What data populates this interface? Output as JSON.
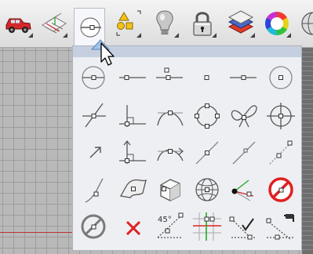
{
  "toolbar": {
    "buttons": [
      {
        "name": "car-icon"
      },
      {
        "name": "grid-icon"
      },
      {
        "name": "osnap-icon"
      },
      {
        "name": "shapes-icon"
      },
      {
        "name": "bulb-icon"
      },
      {
        "name": "lock-icon"
      },
      {
        "name": "layer-icon"
      },
      {
        "name": "color-wheel-icon"
      },
      {
        "name": "sphere-icon"
      }
    ]
  },
  "panel": {
    "label_45": "45°",
    "rows": [
      [
        "end-snap-icon",
        "line-point-icon",
        "mid-snap-icon",
        "point-snap-icon",
        "center-line-icon",
        "circle-center-icon"
      ],
      [
        "intersection-icon",
        "perpendicular-icon",
        "tangent-icon",
        "quadrant-icon",
        "knot-icon",
        "crosshair-icon"
      ],
      [
        "arrow-point-icon",
        "perp-arrow-icon",
        "tangent-arrow-icon",
        "on-line-icon",
        "along-line-icon",
        "dotted-line-icon"
      ],
      [
        "curve-point-icon",
        "surface-point-icon",
        "box-icon",
        "mesh-sphere-icon",
        "axes-point-icon",
        "no-snap-icon"
      ],
      [
        "disable-icon",
        "cancel-icon",
        "angle-45-icon",
        "grid-snap-icon",
        "check-snap-icon",
        "project-snap-icon"
      ]
    ]
  }
}
